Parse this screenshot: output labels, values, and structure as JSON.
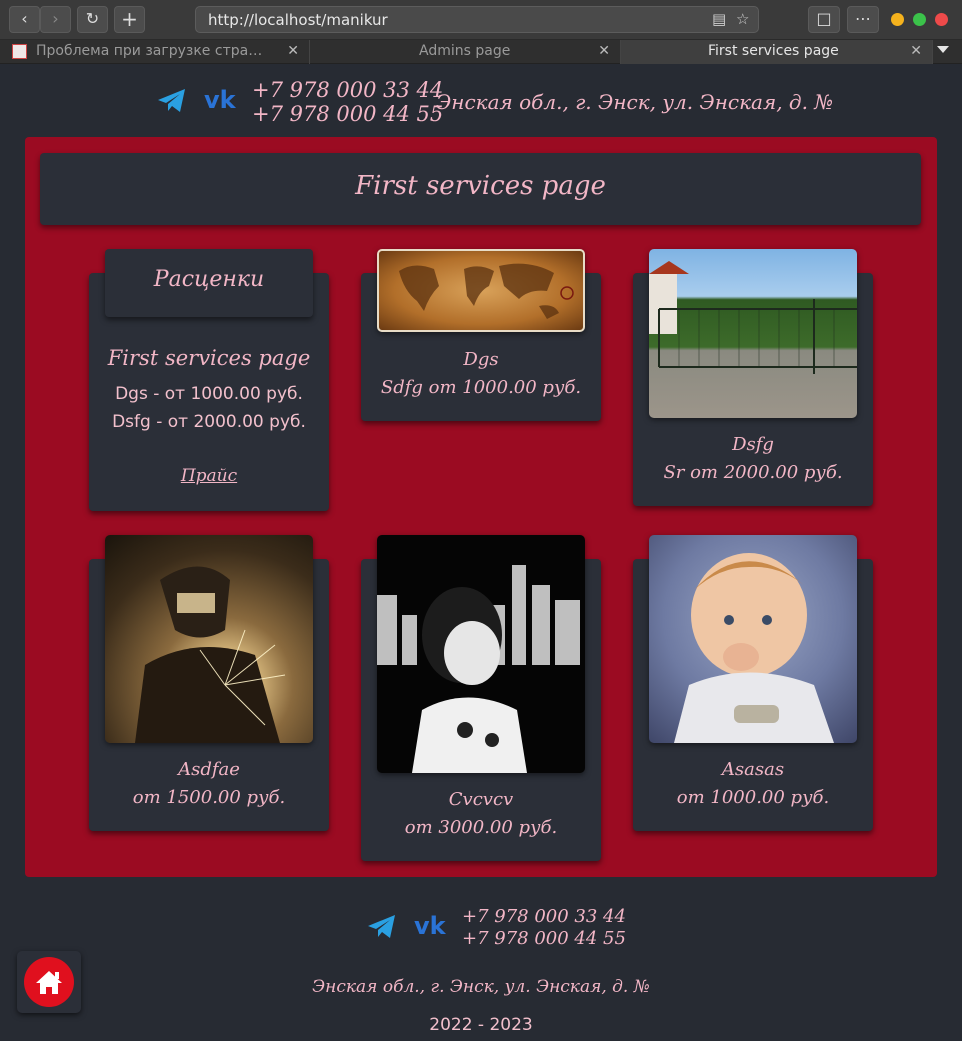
{
  "browser": {
    "url": "http://localhost/manikur",
    "tabs": [
      {
        "title": "Проблема при загрузке стра…",
        "active": false
      },
      {
        "title": "Admins page",
        "active": false
      },
      {
        "title": "First services page",
        "active": true
      }
    ]
  },
  "header": {
    "phone1": "+7 978 000 33 44",
    "phone2": "+7 978 000 44 55",
    "address": "Энская обл., г. Энск, ул. Энская, д. №",
    "vk": "vk"
  },
  "page_title": "First services page",
  "prices": {
    "heading": "Расценки",
    "subtitle": "First services page",
    "lines": [
      "Dgs - от 1000.00 руб.",
      "Dsfg - от 2000.00 руб."
    ],
    "link": "Прайс"
  },
  "services": [
    {
      "name": "Dgs",
      "price": "Sdfg от 1000.00 руб."
    },
    {
      "name": "Dsfg",
      "price": "Sr от 2000.00 руб."
    },
    {
      "name": "Asdfae",
      "price": "от 1500.00 руб."
    },
    {
      "name": "Cvcvcv",
      "price": "от 3000.00 руб."
    },
    {
      "name": "Asasas",
      "price": "от 1000.00 руб."
    }
  ],
  "footer": {
    "phone1": "+7 978 000 33 44",
    "phone2": "+7 978 000 44 55",
    "address": "Энская обл., г. Энск, ул. Энская, д. №",
    "years": "2022 - 2023"
  },
  "colors": {
    "accent": "#9b0b22",
    "dark": "#2b2f38",
    "text": "#f2b6c6",
    "home": "#e0101e"
  }
}
